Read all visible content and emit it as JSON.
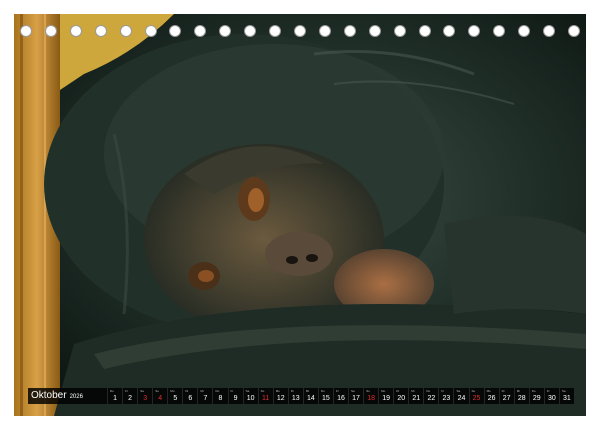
{
  "calendar": {
    "month": "Oktober",
    "year": "2026",
    "weekday_labels": [
      "Do",
      "Fr",
      "Sa",
      "So",
      "Mo",
      "Di",
      "Mi",
      "Do",
      "Fr",
      "Sa",
      "So",
      "Mo",
      "Di",
      "Mi",
      "Do",
      "Fr",
      "Sa",
      "So",
      "Mo",
      "Di",
      "Mi",
      "Do",
      "Fr",
      "Sa",
      "So",
      "Mo",
      "Di",
      "Mi",
      "Do",
      "Fr",
      "Sa"
    ],
    "days": [
      "1",
      "2",
      "3",
      "4",
      "5",
      "6",
      "7",
      "8",
      "9",
      "10",
      "11",
      "12",
      "13",
      "14",
      "15",
      "16",
      "17",
      "18",
      "19",
      "20",
      "21",
      "22",
      "23",
      "24",
      "25",
      "26",
      "27",
      "28",
      "29",
      "30",
      "31"
    ],
    "red_days": [
      3,
      4,
      11,
      18,
      25
    ],
    "accent_red": "#e03030"
  },
  "photo": {
    "subject": "chimpanzee resting head on arm beside wooden post"
  }
}
